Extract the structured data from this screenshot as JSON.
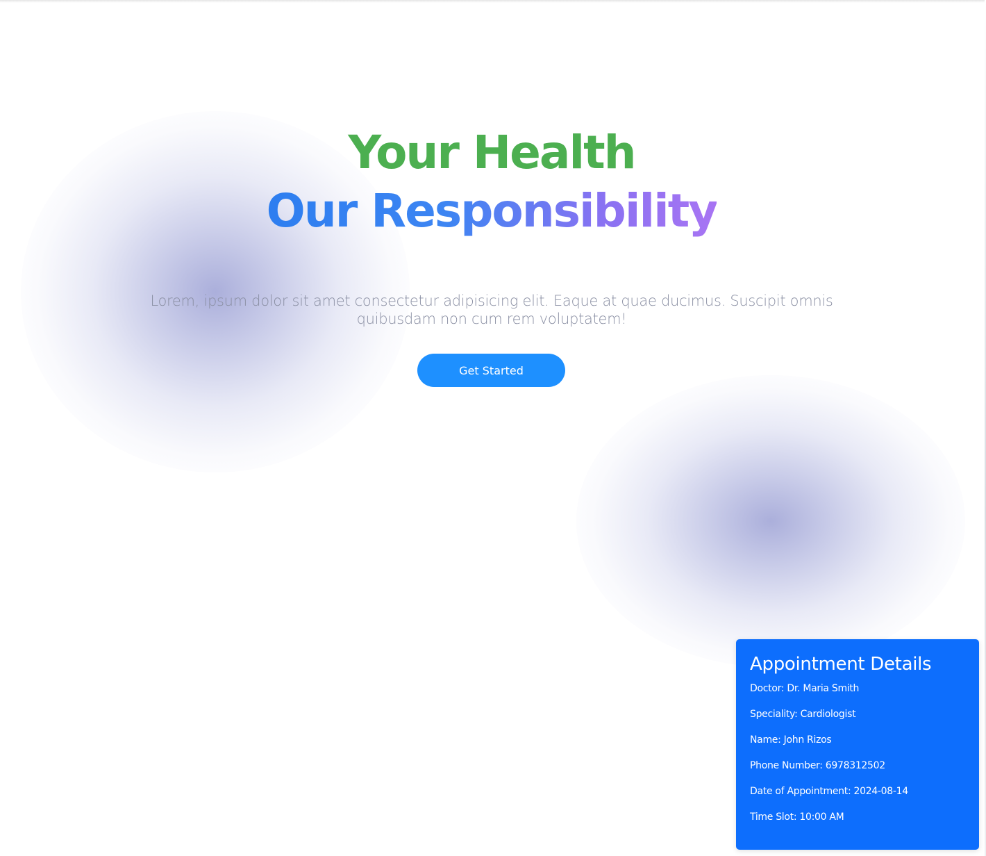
{
  "hero": {
    "title_line1": "Your Health",
    "title_line2": "Our Responsibility",
    "subtitle": "Lorem, ipsum dolor sit amet consectetur adipisicing elit. Eaque at quae ducimus. Suscipit omnis quibusdam non cum rem voluptatem!",
    "cta_label": "Get Started"
  },
  "appointment": {
    "title": "Appointment Details",
    "rows": [
      "Doctor: Dr. Maria Smith",
      "Speciality: Cardiologist",
      "Name: John Rizos",
      "Phone Number: 6978312502",
      "Date of Appointment: 2024-08-14",
      "Time Slot: 10:00 AM"
    ]
  },
  "colors": {
    "title_green": "#4caf50",
    "title_blue": "#2d7ef0",
    "title_purple": "#a874f3",
    "cta_background": "#1e90ff",
    "card_background": "#0d6efd",
    "subtitle_text": "#8a8fa3",
    "blob": "#969bd2"
  }
}
